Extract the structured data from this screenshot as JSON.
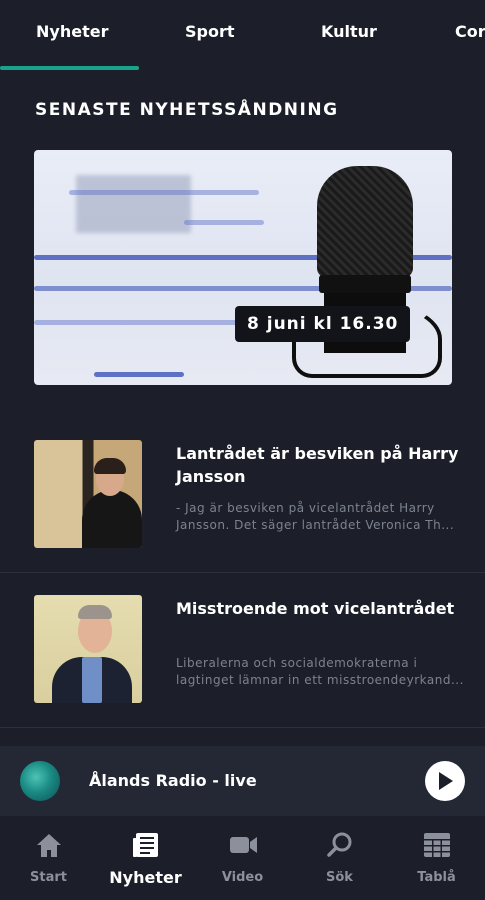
{
  "tabs": [
    {
      "label": "Nyheter",
      "active": true
    },
    {
      "label": "Sport",
      "active": false
    },
    {
      "label": "Kultur",
      "active": false
    },
    {
      "label": "Cor",
      "active": false
    }
  ],
  "section": {
    "title": "SENASTE NYHETSSÅNDNING"
  },
  "hero": {
    "label": "8 juni kl 16.30"
  },
  "news": [
    {
      "title": "Lantrådet är besviken på Harry Jansson",
      "description": "- Jag är besviken på vicelantrådet Harry Jansson. Det säger lantrådet Veronica Th..."
    },
    {
      "title": "Misstroende mot vicelantrådet",
      "description": "Liberalerna och socialdemokraterna i lagtinget lämnar in ett misstroendeyrkand..."
    }
  ],
  "player": {
    "title": "Ålands Radio - live"
  },
  "bottom_nav": [
    {
      "label": "Start",
      "icon": "home-icon",
      "active": false
    },
    {
      "label": "Nyheter",
      "icon": "newspaper-icon",
      "active": true
    },
    {
      "label": "Video",
      "icon": "video-icon",
      "active": false
    },
    {
      "label": "Sök",
      "icon": "search-icon",
      "active": false
    },
    {
      "label": "Tablå",
      "icon": "schedule-grid-icon",
      "active": false
    }
  ],
  "colors": {
    "background": "#1c1f29",
    "accent": "#1aa38c",
    "player_bar": "#242834",
    "muted_text": "#7d8291",
    "nav_inactive": "#8c909c"
  }
}
